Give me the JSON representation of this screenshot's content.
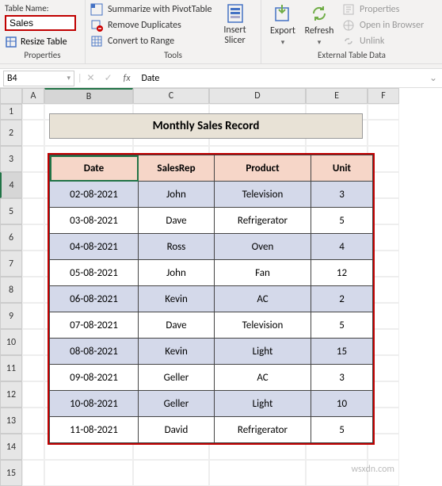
{
  "ribbon": {
    "table_name_label": "Table Name:",
    "table_name_value": "Sales",
    "resize_table": "Resize Table",
    "group1_label": "Properties",
    "summarize": "Summarize with PivotTable",
    "remove_dup": "Remove Duplicates",
    "convert_range": "Convert to Range",
    "group2_label": "Tools",
    "insert_slicer": "Insert Slicer",
    "export": "Export",
    "refresh": "Refresh",
    "properties": "Properties",
    "open_browser": "Open in Browser",
    "unlink": "Unlink",
    "group3_label": "External Table Data"
  },
  "namebox": "B4",
  "formula_value": "Date",
  "cols": [
    "A",
    "B",
    "C",
    "D",
    "E",
    "F"
  ],
  "rows": [
    "1",
    "2",
    "3",
    "4",
    "5",
    "6",
    "7",
    "8",
    "9",
    "10",
    "11",
    "12",
    "13",
    "14",
    "15"
  ],
  "title": "Monthly Sales Record",
  "chart_data": {
    "type": "table",
    "headers": [
      "Date",
      "SalesRep",
      "Product",
      "Unit"
    ],
    "rows": [
      [
        "02-08-2021",
        "John",
        "Television",
        "3"
      ],
      [
        "03-08-2021",
        "Dave",
        "Refrigerator",
        "5"
      ],
      [
        "04-08-2021",
        "Ross",
        "Oven",
        "4"
      ],
      [
        "05-08-2021",
        "John",
        "Fan",
        "12"
      ],
      [
        "06-08-2021",
        "Kevin",
        "AC",
        "2"
      ],
      [
        "07-08-2021",
        "Dave",
        "Television",
        "5"
      ],
      [
        "08-08-2021",
        "Kevin",
        "Light",
        "15"
      ],
      [
        "09-08-2021",
        "Geller",
        "AC",
        "3"
      ],
      [
        "10-08-2021",
        "Geller",
        "Light",
        "10"
      ],
      [
        "11-08-2021",
        "David",
        "Refrigerator",
        "5"
      ]
    ]
  },
  "watermark": "wsxdn.com"
}
